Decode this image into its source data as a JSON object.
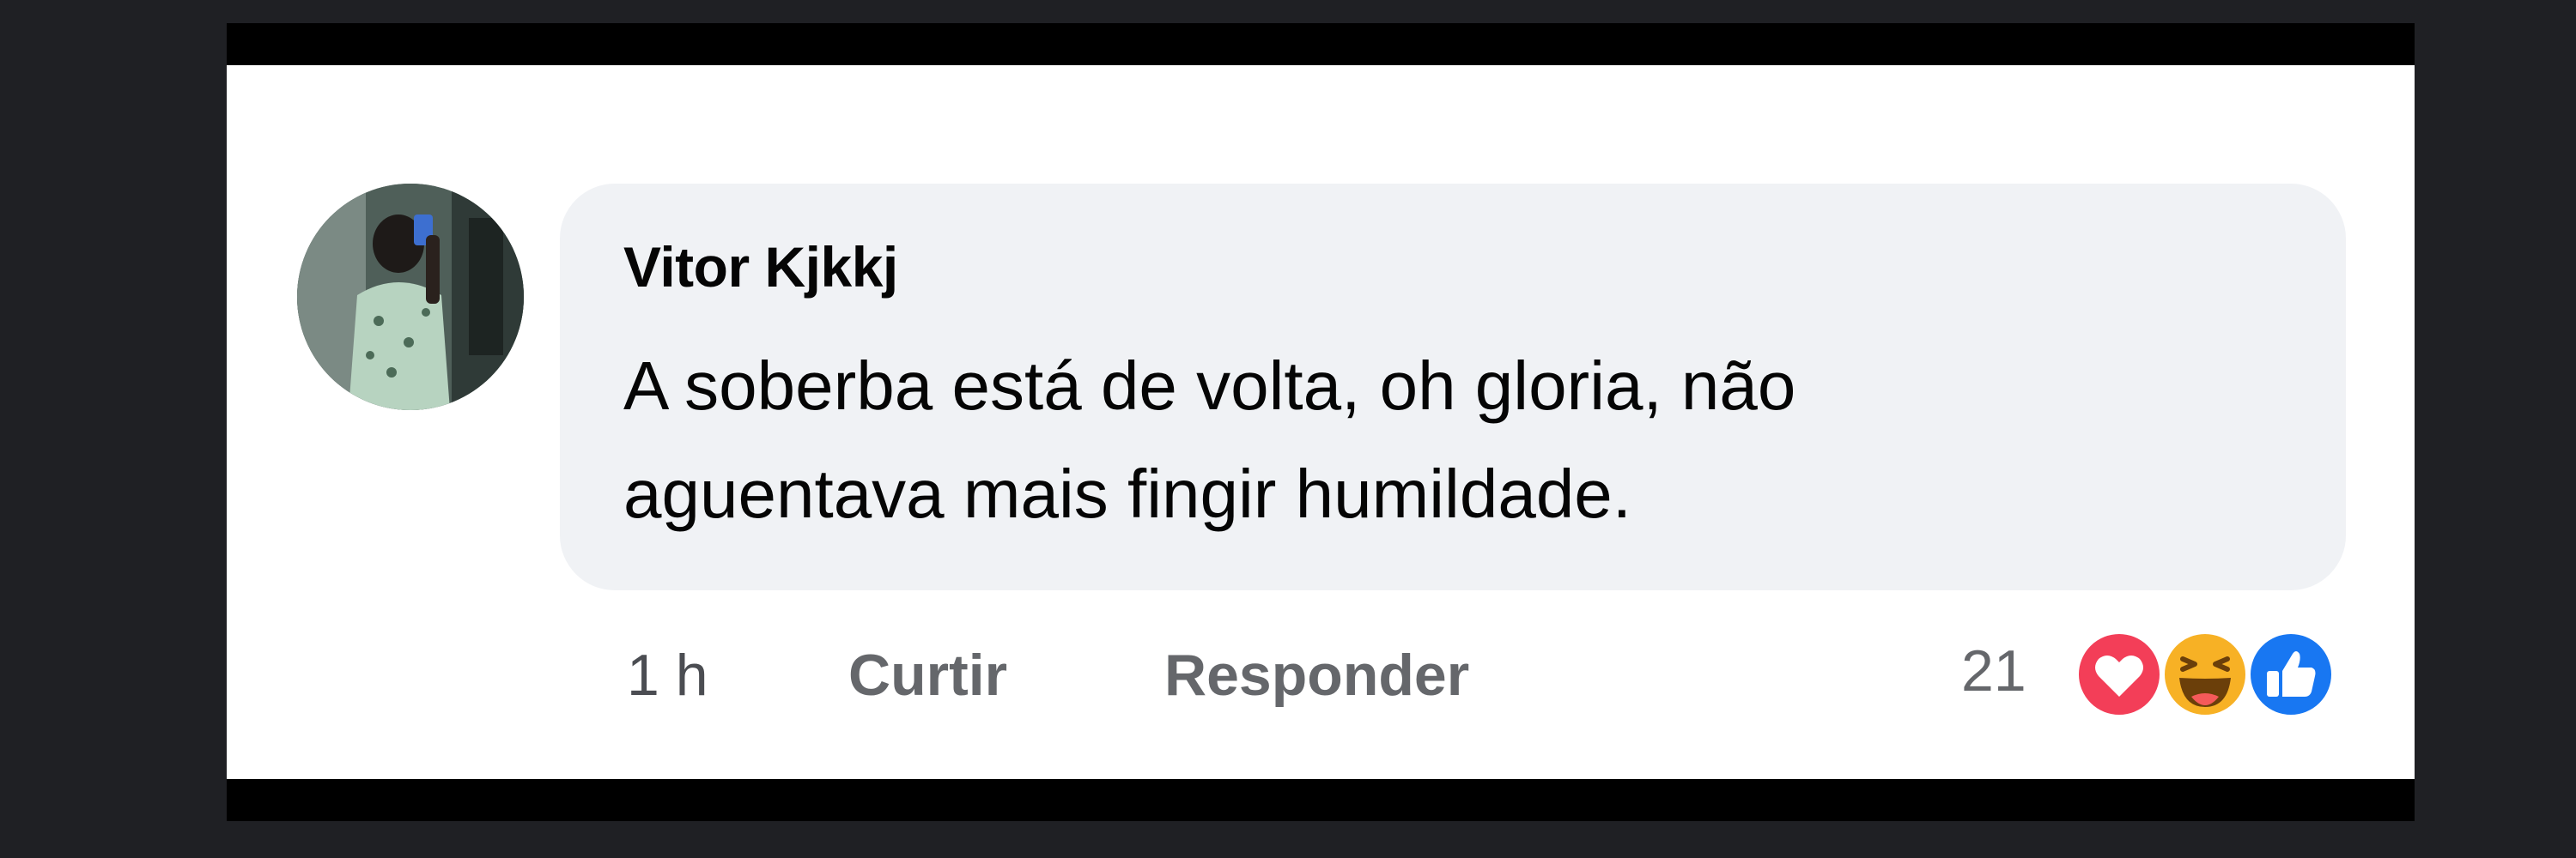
{
  "comment": {
    "author": "Vitor Kjkkj",
    "text_line1": "A soberba está de volta, oh gloria, não",
    "text_line2": "aguentava mais fingir humildade."
  },
  "actions": {
    "time": "1 h",
    "like_label": "Curtir",
    "reply_label": "Responder"
  },
  "reactions": {
    "count": "21",
    "icons": [
      "love-icon",
      "haha-icon",
      "like-icon"
    ]
  },
  "colors": {
    "background": "#1f2024",
    "card": "#ffffff",
    "bubble": "#f0f2f5",
    "text": "#050505",
    "muted": "#65676b",
    "love": "#f33e58",
    "haha": "#f7b125",
    "like": "#1877f2"
  }
}
